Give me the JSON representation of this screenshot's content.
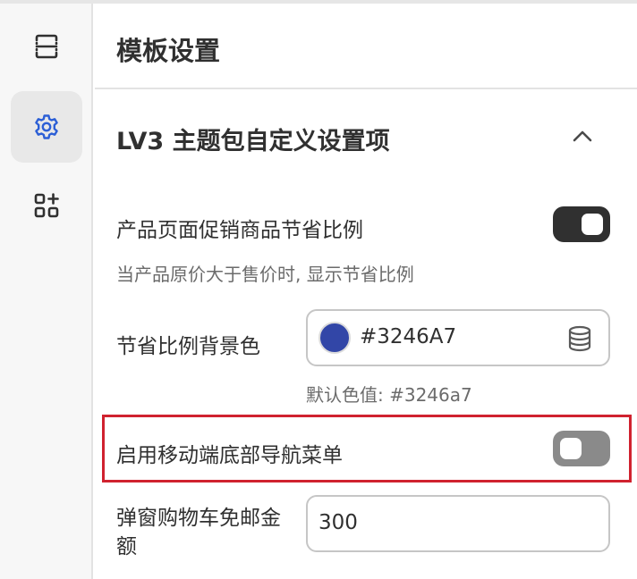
{
  "panel": {
    "title": "模板设置"
  },
  "rail": {
    "items": [
      {
        "icon": "sections-icon",
        "active": false
      },
      {
        "icon": "gear-icon",
        "active": true
      },
      {
        "icon": "apps-add-icon",
        "active": false
      }
    ]
  },
  "section": {
    "title": "LV3 主题包自定义设置项",
    "expanded": true,
    "settings": {
      "savings_toggle": {
        "label": "产品页面促销商品节省比例",
        "help": "当产品原价大于售价时, 显示节省比例",
        "checked": true
      },
      "savings_bg_color": {
        "label": "节省比例背景色",
        "value": "#3246A7",
        "default_hint": "默认色值: #3246a7"
      },
      "mobile_bottom_nav": {
        "label": "启用移动端底部导航菜单",
        "checked": false
      },
      "free_shipping_amount": {
        "label_line1": "弹窗购物车免邮金",
        "label_line2": "额",
        "value": "300"
      }
    }
  },
  "colors": {
    "accent_active_icon": "#2c5fd6",
    "swatch": "#3246A7",
    "highlight_border": "#d0222f"
  }
}
